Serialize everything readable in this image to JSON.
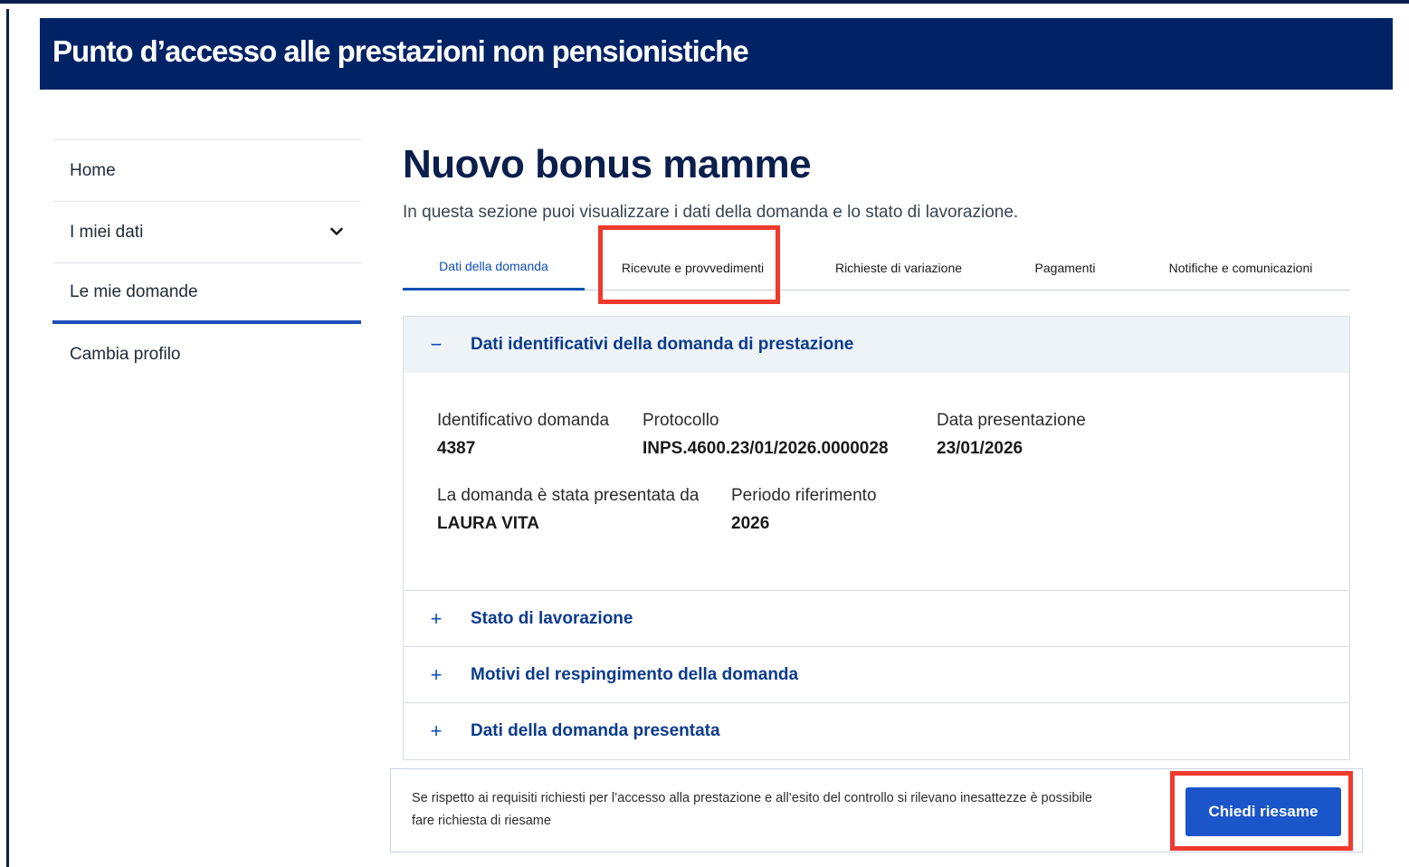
{
  "header": {
    "title": "Punto d’accesso alle prestazioni non pensionistiche"
  },
  "sidebar": {
    "items": [
      {
        "label": "Home"
      },
      {
        "label": "I miei dati"
      },
      {
        "label": "Le mie domande"
      },
      {
        "label": "Cambia profilo"
      }
    ]
  },
  "page": {
    "title": "Nuovo bonus mamme",
    "subtitle": "In questa sezione puoi visualizzare i dati della domanda e lo stato di lavorazione."
  },
  "tabs": [
    {
      "label": "Dati della domanda"
    },
    {
      "label": "Ricevute e provvedimenti"
    },
    {
      "label": "Richieste di variazione"
    },
    {
      "label": "Pagamenti"
    },
    {
      "label": "Notifiche e comunicazioni"
    }
  ],
  "accordion": {
    "open_section": {
      "sign": "−",
      "title": "Dati identificativi della domanda di prestazione",
      "fields": {
        "id_label": "Identificativo domanda",
        "id_value": "4387",
        "protocol_label": "Protocollo",
        "protocol_value": "INPS.4600.23/01/2026.0000028",
        "date_label": "Data presentazione",
        "date_value": "23/01/2026",
        "presenter_label": "La domanda è stata presentata da",
        "presenter_value": "LAURA VITA",
        "period_label": "Periodo riferimento",
        "period_value": "2026"
      }
    },
    "collapsed_sections": [
      {
        "sign": "+",
        "title": "Stato di lavorazione"
      },
      {
        "sign": "+",
        "title": "Motivi del respingimento della domanda"
      },
      {
        "sign": "+",
        "title": "Dati della domanda presentata"
      }
    ]
  },
  "notice": {
    "text": "Se rispetto ai requisiti richiesti per l’accesso alla prestazione e all’esito del controllo si rilevano inesattezze è possibile fare richiesta di riesame",
    "button_label": "Chiedi riesame"
  },
  "colors": {
    "header_bg": "#002366",
    "accent": "#0b4fb3",
    "highlight": "#ef3a2d",
    "button_bg": "#1a56c9"
  }
}
